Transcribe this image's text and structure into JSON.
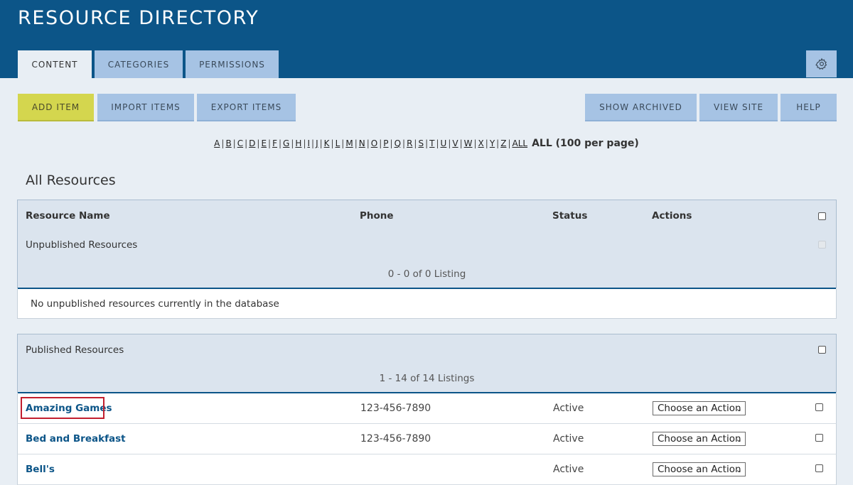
{
  "header": {
    "title": "RESOURCE DIRECTORY"
  },
  "tabs": [
    {
      "label": "CONTENT",
      "active": true
    },
    {
      "label": "CATEGORIES",
      "active": false
    },
    {
      "label": "PERMISSIONS",
      "active": false
    }
  ],
  "settings_icon": "gear-icon",
  "toolbar": {
    "add_item": "ADD ITEM",
    "import_items": "IMPORT ITEMS",
    "export_items": "EXPORT ITEMS",
    "show_archived": "SHOW ARCHIVED",
    "view_site": "VIEW SITE",
    "help": "HELP"
  },
  "alpha": {
    "letters": [
      "A",
      "B",
      "C",
      "D",
      "E",
      "F",
      "G",
      "H",
      "I",
      "J",
      "K",
      "L",
      "M",
      "N",
      "O",
      "P",
      "Q",
      "R",
      "S",
      "T",
      "U",
      "V",
      "W",
      "X",
      "Y",
      "Z",
      "ALL"
    ],
    "current": "ALL (100 per page)"
  },
  "section_title": "All Resources",
  "table": {
    "headers": {
      "name": "Resource Name",
      "phone": "Phone",
      "status": "Status",
      "actions": "Actions"
    }
  },
  "unpublished": {
    "label": "Unpublished Resources",
    "listing": "0 - 0 of 0 Listing",
    "empty_message": "No unpublished resources currently in the database"
  },
  "published": {
    "label": "Published Resources",
    "listing": "1 - 14 of 14 Listings",
    "rows": [
      {
        "name": "Amazing Games",
        "phone": "123-456-7890",
        "status": "Active",
        "action": "Choose an Action"
      },
      {
        "name": "Bed and Breakfast",
        "phone": "123-456-7890",
        "status": "Active",
        "action": "Choose an Action"
      },
      {
        "name": "Bell's",
        "phone": "",
        "status": "Active",
        "action": "Choose an Action"
      }
    ]
  },
  "colors": {
    "header": "#0c5588",
    "tab": "#a6c3e4",
    "primary_button": "#d4d64e",
    "highlight": "#c21e2e"
  }
}
